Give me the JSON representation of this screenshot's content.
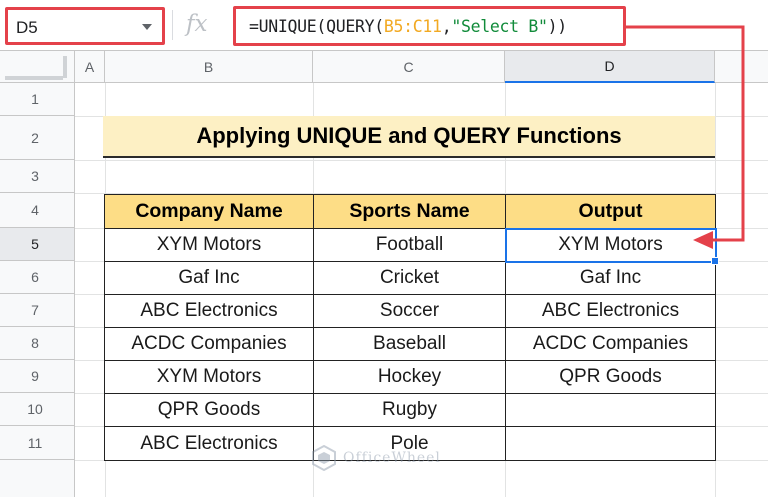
{
  "name_box": {
    "value": "D5"
  },
  "formula": {
    "prefix": "=UNIQUE(QUERY(",
    "range": "B5:C11",
    "comma": ",",
    "query": "\"Select B\"",
    "suffix": "))"
  },
  "columns": [
    "A",
    "B",
    "C",
    "D"
  ],
  "active_column": "D",
  "rows": [
    "1",
    "2",
    "3",
    "4",
    "5",
    "6",
    "7",
    "8",
    "9",
    "10",
    "11"
  ],
  "active_row": "5",
  "title": "Applying UNIQUE and QUERY Functions",
  "table": {
    "headers": [
      "Company Name",
      "Sports Name",
      "Output"
    ],
    "rows": [
      [
        "XYM Motors",
        "Football",
        "XYM Motors"
      ],
      [
        "Gaf Inc",
        "Cricket",
        "Gaf Inc"
      ],
      [
        "ABC Electronics",
        "Soccer",
        "ABC Electronics"
      ],
      [
        "ACDC Companies",
        "Baseball",
        "ACDC Companies"
      ],
      [
        "XYM Motors",
        "Hockey",
        "QPR Goods"
      ],
      [
        "QPR Goods",
        "Rugby",
        ""
      ],
      [
        "ABC Electronics",
        "Pole",
        ""
      ]
    ]
  },
  "watermark": {
    "text": "OfficeWheel"
  },
  "colors": {
    "highlight_border": "#e4414a",
    "selection": "#1a73e8",
    "header_fill": "#fddd86",
    "title_fill": "#fdf0c4"
  }
}
